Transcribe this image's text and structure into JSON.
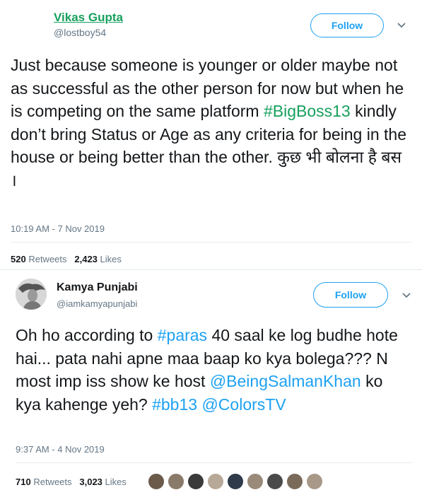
{
  "tweets": [
    {
      "name": "Vikas Gupta",
      "handle": "@lostboy54",
      "follow_label": "Follow",
      "text_parts": [
        "Just because someone is younger or older maybe not as successful as the other person for now but when he is competing on the same platform ",
        "#BigBoss13",
        " kindly don’t bring Status or Age as any criteria for being in the house or being better than the other. कुछ भी बोलना है बस ।"
      ],
      "timestamp": "10:19 AM - 7 Nov 2019",
      "retweets_count": "520",
      "retweets_label": "Retweets",
      "likes_count": "2,423",
      "likes_label": "Likes"
    },
    {
      "name": "Kamya Punjabi",
      "handle": "@iamkamyapunjabi",
      "follow_label": "Follow",
      "text_parts": {
        "p1": "Oh ho according to ",
        "h1": "#paras",
        "p2": " 40 saal ke log budhe hote hai... pata nahi apne maa baap ko kya bolega??? N most imp iss show ke host ",
        "m1": "@BeingSalmanKhan",
        "p3": " ko kya kahenge yeh? ",
        "h2": "#bb13",
        "p4": " ",
        "m2": "@ColorsTV"
      },
      "timestamp": "9:37 AM - 4 Nov 2019",
      "retweets_count": "710",
      "retweets_label": "Retweets",
      "likes_count": "3,023",
      "likes_label": "Likes"
    }
  ],
  "colors": {
    "link_blue": "#1da1f2",
    "hashtag_green": "#17a05d",
    "name_green": "#17a05d",
    "meta_gray": "#657786"
  },
  "icons": [
    "chevron-down-icon",
    "avatar",
    "liker-avatar"
  ]
}
